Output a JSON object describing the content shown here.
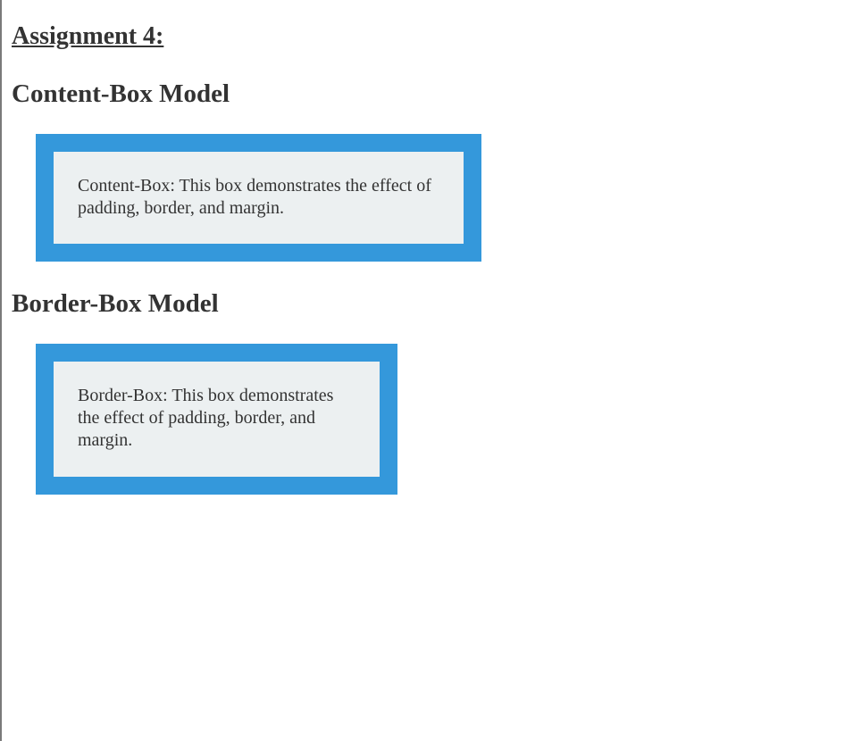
{
  "title": "Assignment 4:",
  "sections": {
    "content_box": {
      "heading": "Content-Box Model",
      "text": "Content-Box: This box demonstrates the effect of padding, border, and margin."
    },
    "border_box": {
      "heading": "Border-Box Model",
      "text": "Border-Box: This box demonstrates the effect of padding, border, and margin."
    }
  },
  "colors": {
    "border": "#3498db",
    "box_background": "#ecf0f1",
    "text": "#333333"
  }
}
